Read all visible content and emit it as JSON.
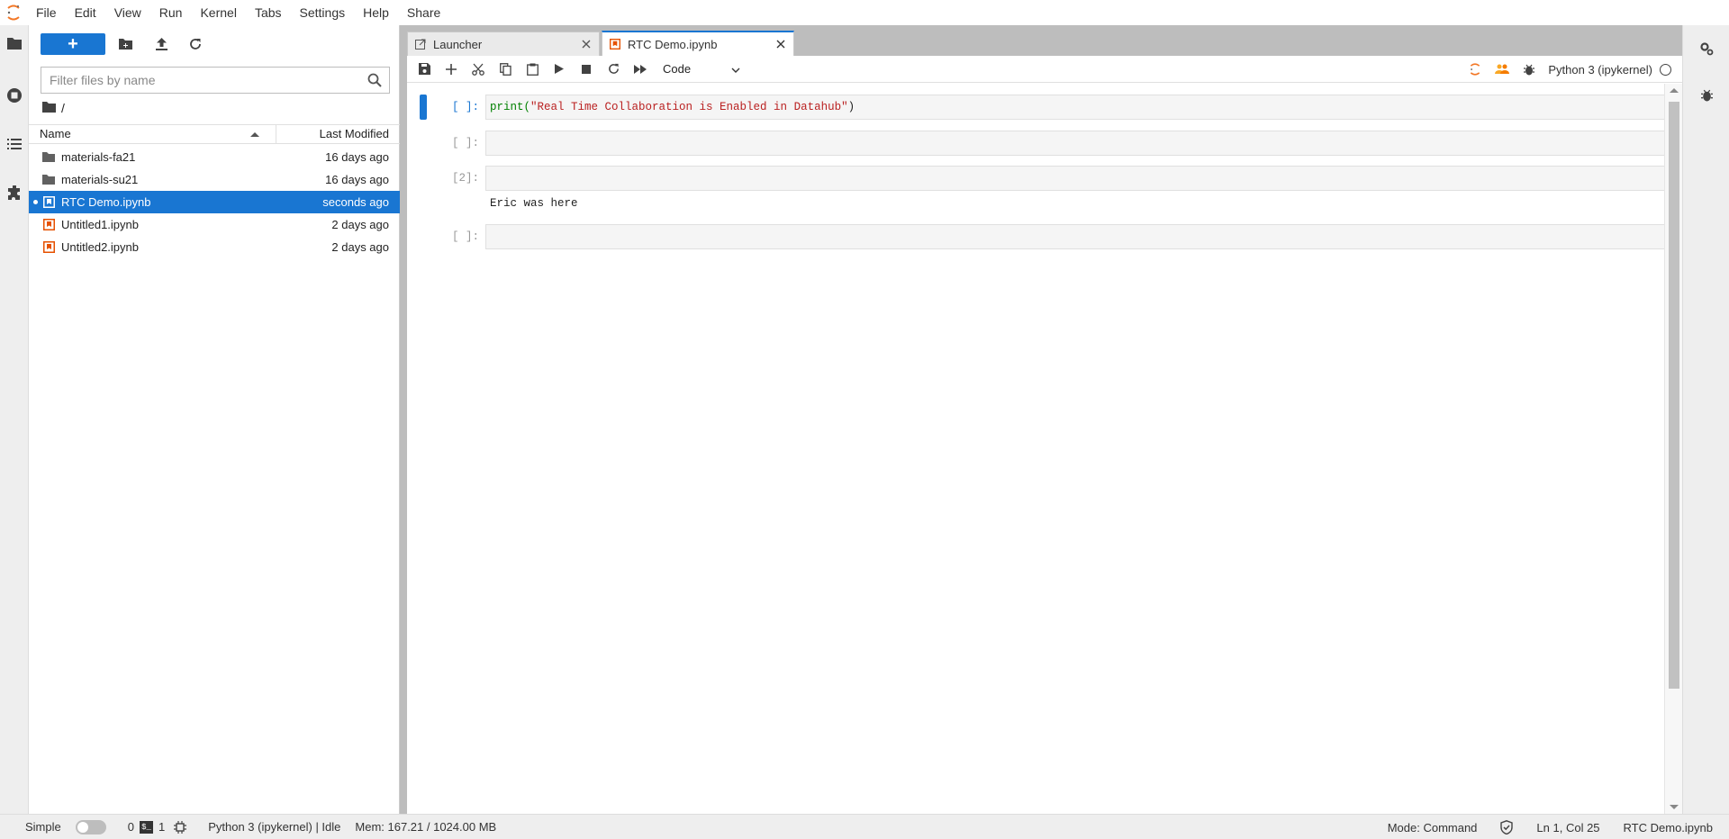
{
  "menubar": {
    "items": [
      "File",
      "Edit",
      "View",
      "Run",
      "Kernel",
      "Tabs",
      "Settings",
      "Help",
      "Share"
    ]
  },
  "filebrowser": {
    "new_label": "+",
    "search_placeholder": "Filter files by name",
    "breadcrumb": "/",
    "columns": {
      "name": "Name",
      "modified": "Last Modified"
    },
    "files": [
      {
        "name": "materials-fa21",
        "modified": "16 days ago",
        "type": "folder",
        "selected": false
      },
      {
        "name": "materials-su21",
        "modified": "16 days ago",
        "type": "folder",
        "selected": false
      },
      {
        "name": "RTC Demo.ipynb",
        "modified": "seconds ago",
        "type": "notebook",
        "selected": true
      },
      {
        "name": "Untitled1.ipynb",
        "modified": "2 days ago",
        "type": "notebook",
        "selected": false
      },
      {
        "name": "Untitled2.ipynb",
        "modified": "2 days ago",
        "type": "notebook",
        "selected": false
      }
    ]
  },
  "tabs": [
    {
      "label": "Launcher",
      "active": false
    },
    {
      "label": "RTC Demo.ipynb",
      "active": true
    }
  ],
  "notebook": {
    "cell_type": "Code",
    "kernel_name": "Python 3 (ipykernel)",
    "cells": [
      {
        "prompt": "[ ]:",
        "code_fn": "print(",
        "code_str": "\"Real Time Collaboration is Enabled in Datahub\"",
        "code_end": ")",
        "output": ""
      },
      {
        "prompt": "[ ]:",
        "code_fn": "",
        "code_str": "",
        "code_end": "",
        "output": ""
      },
      {
        "prompt": "[2]:",
        "code_fn": "",
        "code_str": "",
        "code_end": "",
        "output": "Eric was here"
      },
      {
        "prompt": "[ ]:",
        "code_fn": "",
        "code_str": "",
        "code_end": "",
        "output": ""
      }
    ]
  },
  "statusbar": {
    "simple_label": "Simple",
    "count_a": "0",
    "terminal_badge": "$_",
    "count_b": "1",
    "kernel_status": "Python 3 (ipykernel) | Idle",
    "memory": "Mem: 167.21 / 1024.00 MB",
    "mode": "Mode: Command",
    "position": "Ln 1, Col 25",
    "filename": "RTC Demo.ipynb"
  },
  "colors": {
    "accent": "#1976d2",
    "notebook_icon": "#e65100",
    "logo_orange": "#f37726"
  }
}
